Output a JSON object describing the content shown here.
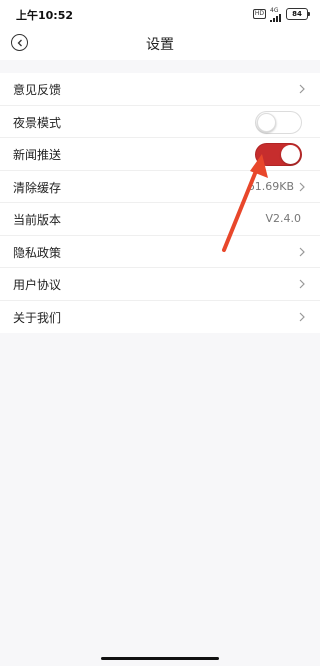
{
  "status_bar": {
    "time": "上午10:52",
    "hd": "HD",
    "network": "4G",
    "battery": "84"
  },
  "header": {
    "title": "设置"
  },
  "settings": {
    "items": [
      {
        "label": "意见反馈"
      },
      {
        "label": "夜景模式",
        "toggle": "off"
      },
      {
        "label": "新闻推送",
        "toggle": "on"
      },
      {
        "label": "清除缓存",
        "value": "61.69KB"
      },
      {
        "label": "当前版本",
        "value": "V2.4.0"
      },
      {
        "label": "隐私政策"
      },
      {
        "label": "用户协议"
      },
      {
        "label": "关于我们"
      }
    ]
  },
  "colors": {
    "toggle_on": "#c62d2d",
    "annotation_arrow": "#e8472b"
  }
}
